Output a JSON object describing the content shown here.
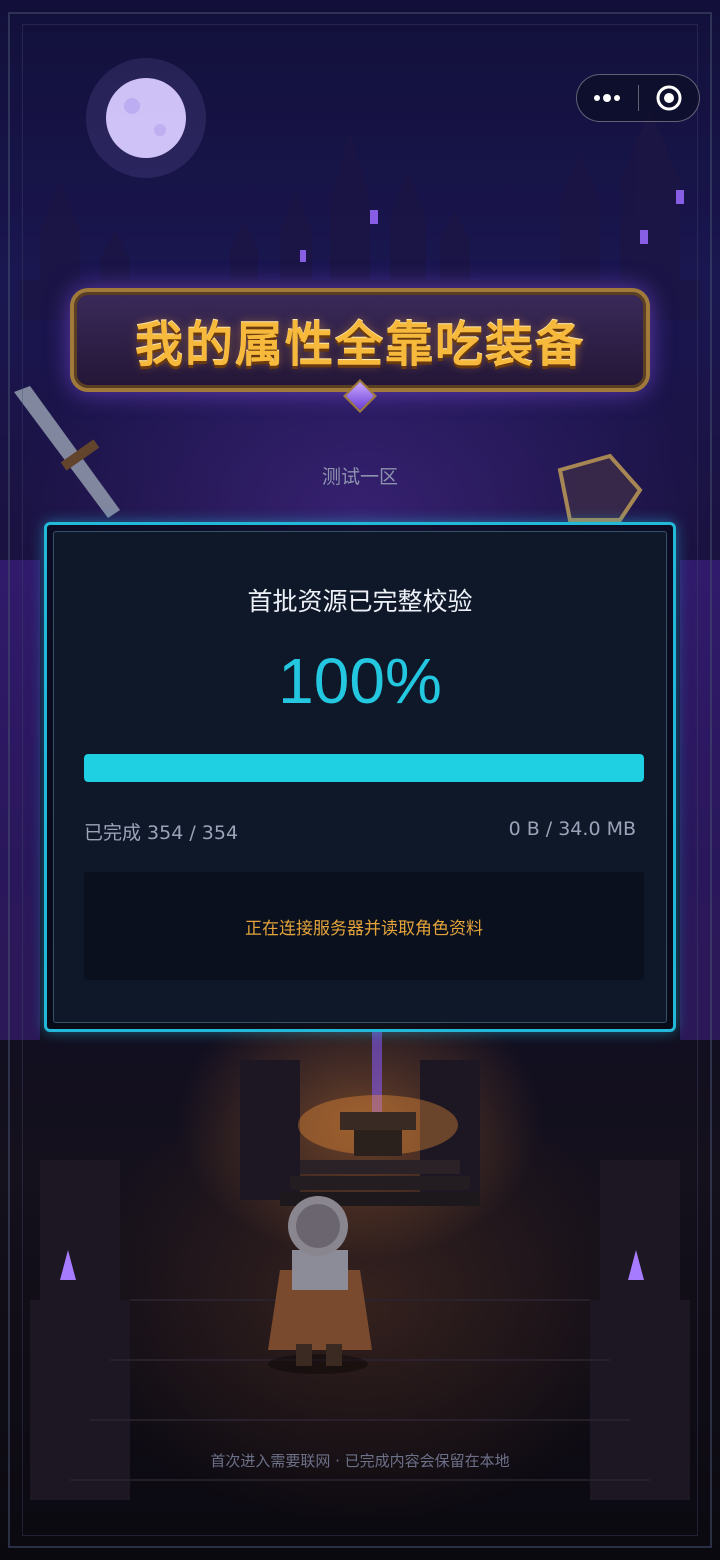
{
  "game": {
    "title": "我的属性全靠吃装备",
    "server": "测试一区"
  },
  "capsule": {
    "more_icon": "more-dots-icon",
    "close_icon": "target-circle-icon"
  },
  "loader": {
    "heading": "首批资源已完整校验",
    "percent_text": "100%",
    "progress": 1.0,
    "files_done": "已完成 354 / 354",
    "size_text": "0 B / 34.0 MB",
    "status": "正在连接服务器并读取角色资料"
  },
  "footer": {
    "note": "首次进入需要联网 · 已完成内容会保留在本地"
  },
  "colors": {
    "accent": "#1fd0e3",
    "card_border": "#24b8d8",
    "status_text": "#e4a43a",
    "title_gold": "#f6b93c"
  }
}
